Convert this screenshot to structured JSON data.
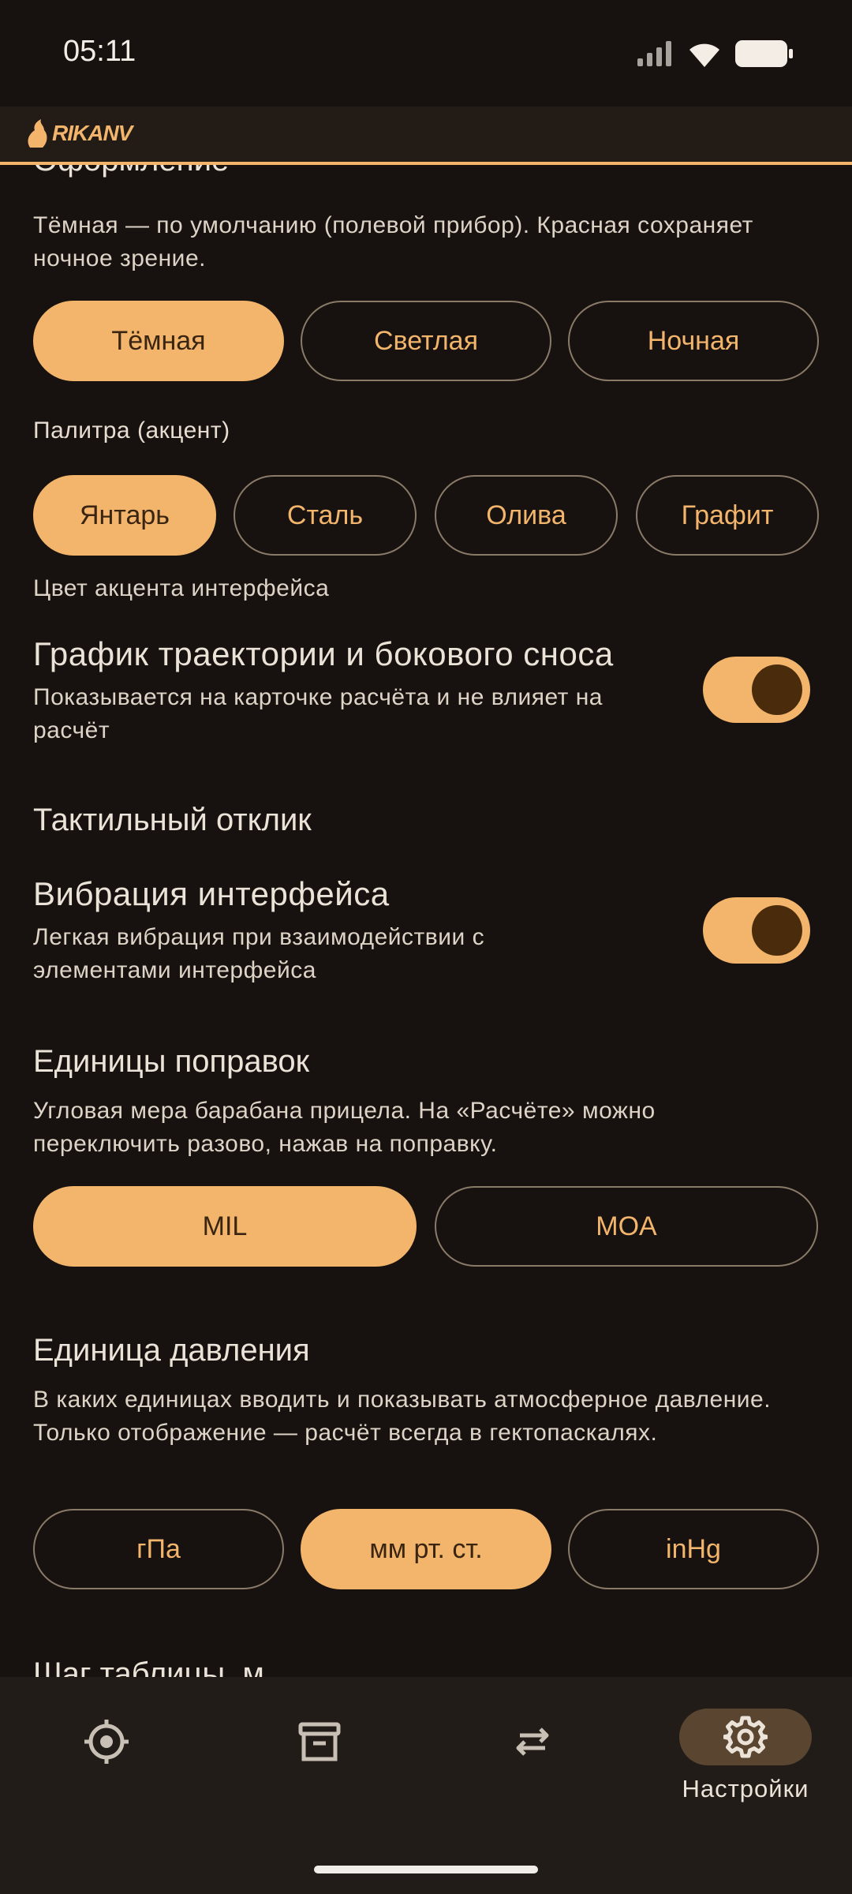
{
  "status_bar": {
    "time": "05:11"
  },
  "app_bar": {
    "logo_text": "RIKANV"
  },
  "theme": {
    "heading_partial": "Оформление",
    "description": "Тёмная — по умолчанию (полевой прибор). Красная сохраняет ночное зрение.",
    "options": [
      "Тёмная",
      "Светлая",
      "Ночная"
    ],
    "selected": "Тёмная"
  },
  "palette": {
    "label": "Палитра (акцент)",
    "options": [
      "Янтарь",
      "Сталь",
      "Олива",
      "Графит"
    ],
    "selected": "Янтарь",
    "hint": "Цвет акцента интерфейса"
  },
  "trajectory_chart": {
    "title": "График траектории и бокового сноса",
    "subtitle": "Показывается на карточке расчёта и не влияет на расчёт",
    "enabled": true
  },
  "haptics": {
    "section_title": "Тактильный отклик",
    "item_title": "Вибрация интерфейса",
    "item_subtitle": "Легкая вибрация при взаимодействии с элементами интерфейса",
    "enabled": true
  },
  "correction_units": {
    "title": "Единицы поправок",
    "description": "Угловая мера барабана прицела. На «Расчёте» можно переключить разово, нажав на поправку.",
    "options": [
      "MIL",
      "MOA"
    ],
    "selected": "MIL"
  },
  "pressure_units": {
    "title": "Единица давления",
    "description": "В каких единицах вводить и показывать атмосферное давление. Только отображение — расчёт всегда в гектопаскалях.",
    "options": [
      "гПа",
      "мм рт. ст.",
      "inHg"
    ],
    "selected": "мм рт. ст."
  },
  "table_step": {
    "title_partial": "Шаг таблицы, м"
  },
  "bottom_nav": {
    "items": [
      {
        "icon": "target-icon",
        "label": ""
      },
      {
        "icon": "archive-icon",
        "label": ""
      },
      {
        "icon": "swap-arrows-icon",
        "label": ""
      },
      {
        "icon": "gear-icon",
        "label": "Настройки"
      }
    ],
    "active_index": 3
  },
  "colors": {
    "background": "#17120f",
    "accent": "#f2b56b",
    "text": "#ece3d8"
  }
}
